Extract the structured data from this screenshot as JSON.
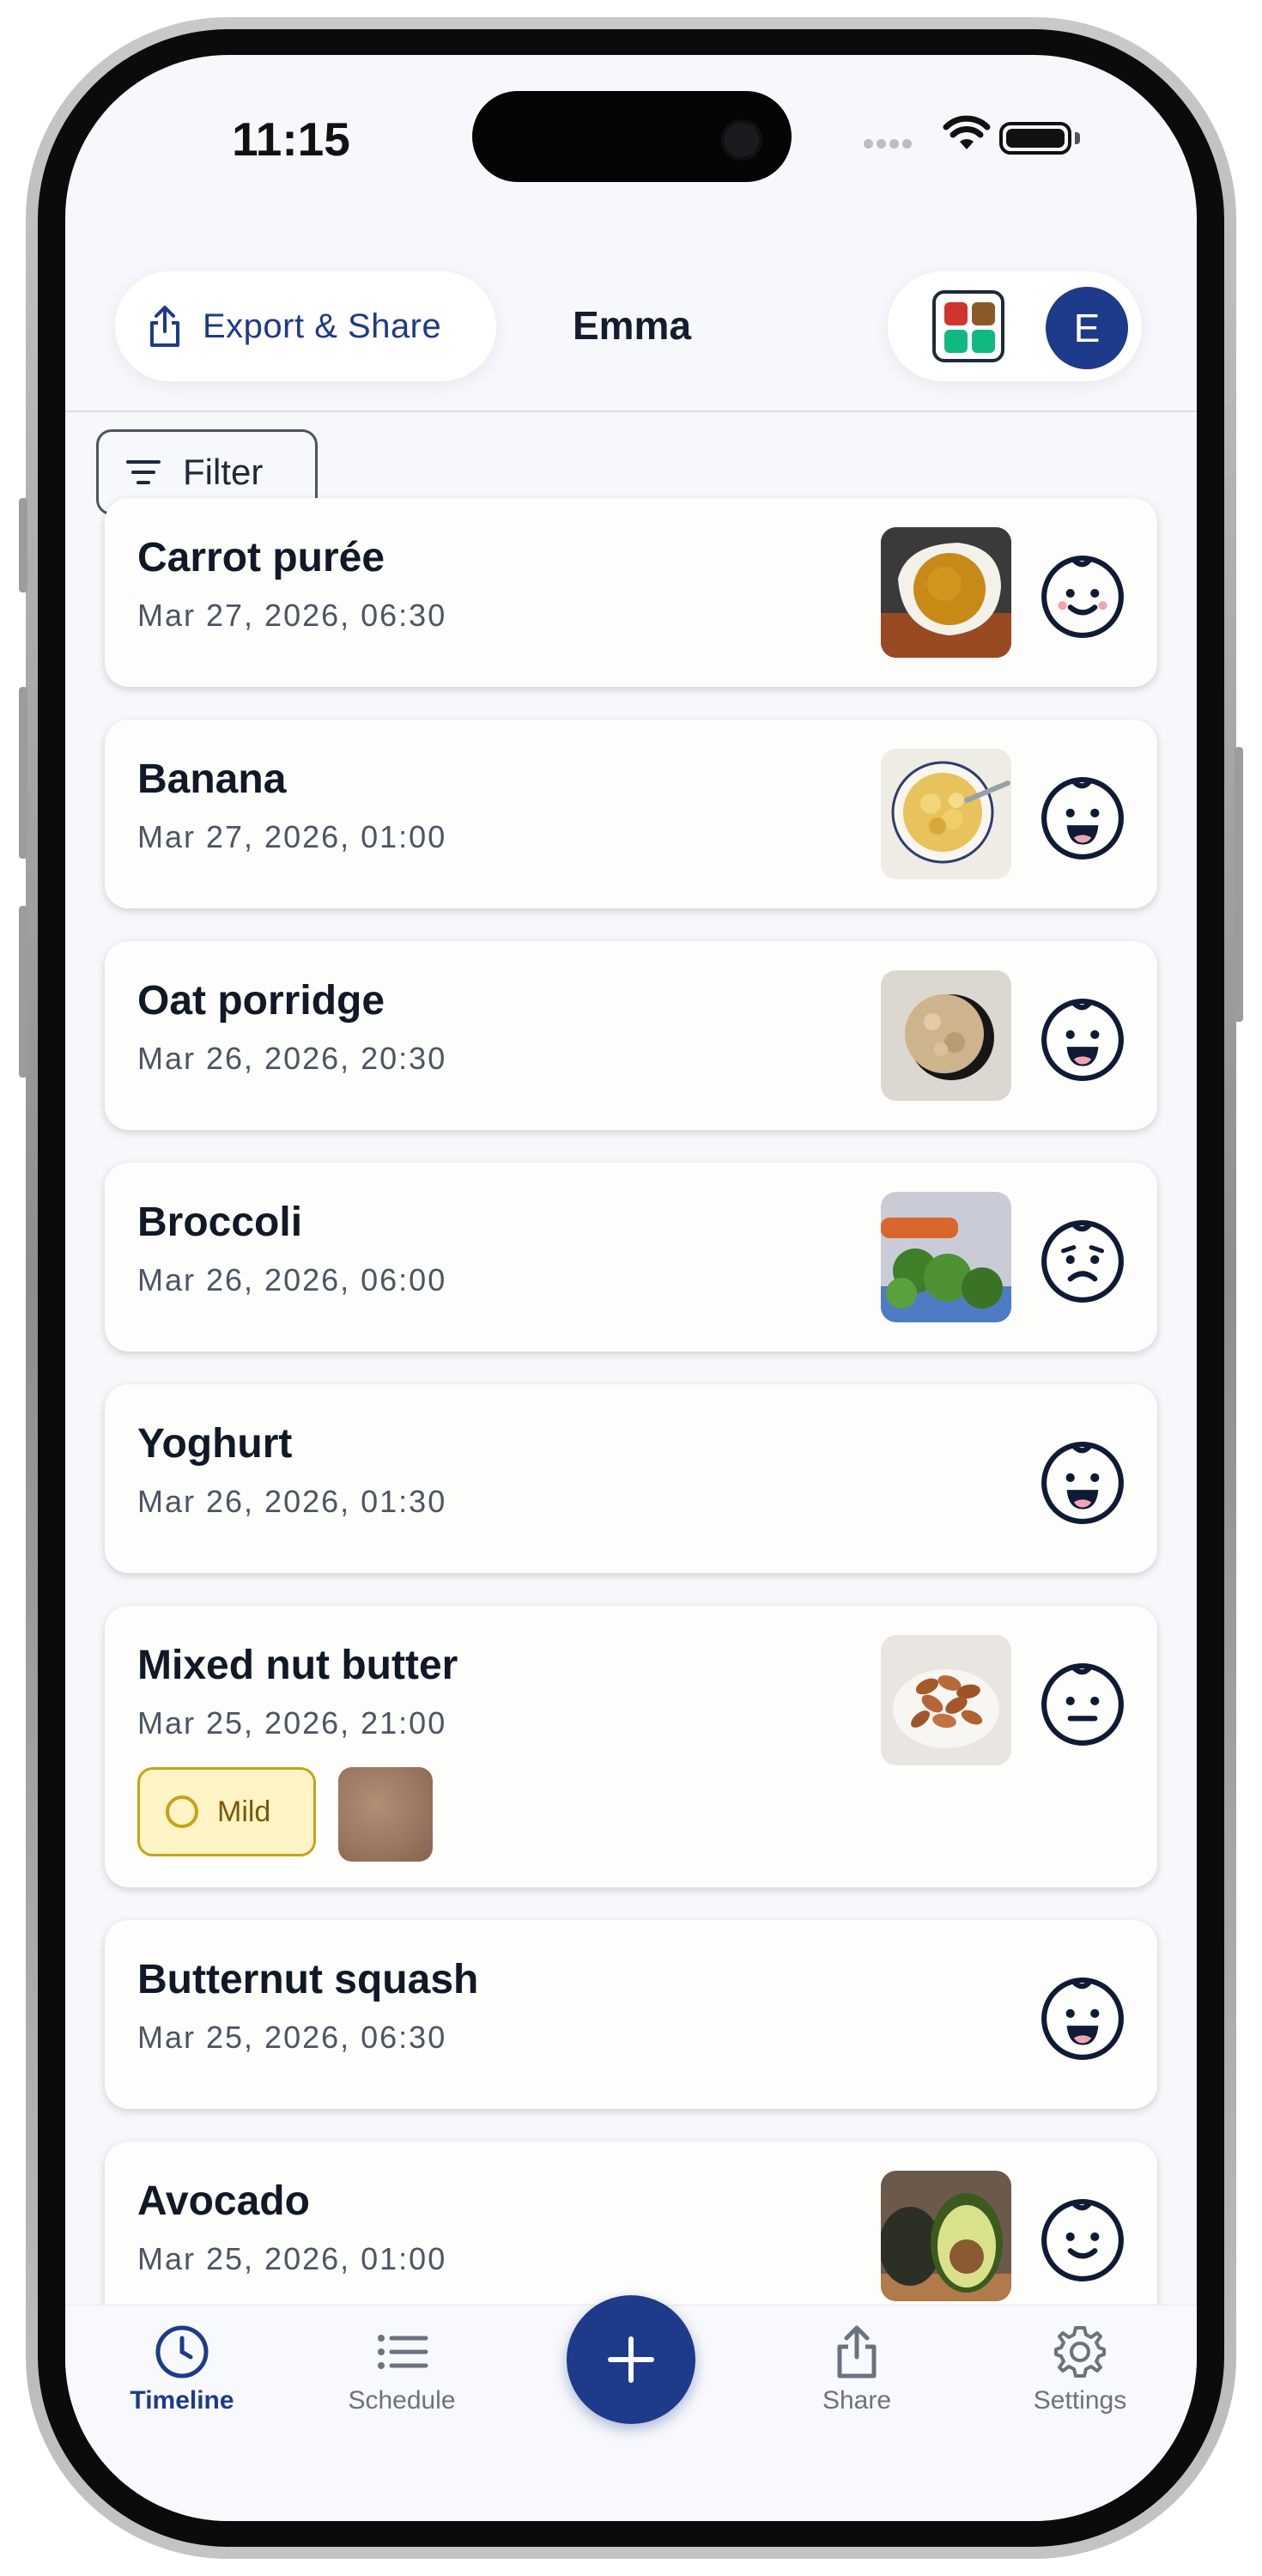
{
  "status_bar": {
    "time": "11:15"
  },
  "header": {
    "export_label": "Export & Share",
    "title": "Emma",
    "avatar_initial": "E"
  },
  "filter": {
    "label": "Filter"
  },
  "entries": [
    {
      "name": "Carrot purée",
      "date": "Mar 27, 2026, 06:30",
      "reaction": "happy",
      "photo": "carrot-puree-bowl"
    },
    {
      "name": "Banana",
      "date": "Mar 27, 2026, 01:00",
      "reaction": "laughing",
      "photo": "banana-bowl"
    },
    {
      "name": "Oat porridge",
      "date": "Mar 26, 2026, 20:30",
      "reaction": "laughing",
      "photo": "oats-bowl"
    },
    {
      "name": "Broccoli",
      "date": "Mar 26, 2026, 06:00",
      "reaction": "sad",
      "photo": "broccoli"
    },
    {
      "name": "Yoghurt",
      "date": "Mar 26, 2026, 01:30",
      "reaction": "laughing",
      "photo": null
    },
    {
      "name": "Mixed nut butter",
      "date": "Mar 25, 2026, 21:00",
      "reaction": "neutral",
      "photo": "almonds-bowl",
      "badge": "Mild"
    },
    {
      "name": "Butternut squash",
      "date": "Mar 25, 2026, 06:30",
      "reaction": "laughing",
      "photo": null
    },
    {
      "name": "Avocado",
      "date": "Mar 25, 2026, 01:00",
      "reaction": "happy",
      "photo": "avocado"
    }
  ],
  "nav": {
    "timeline": "Timeline",
    "schedule": "Schedule",
    "share": "Share",
    "settings": "Settings",
    "add_icon": "plus-icon"
  },
  "colors": {
    "accent": "#1e3a8a",
    "text_dark": "#111827",
    "text_muted": "#4b5563",
    "mild_bg": "#fef4c5",
    "mild_border": "#c7a317"
  }
}
